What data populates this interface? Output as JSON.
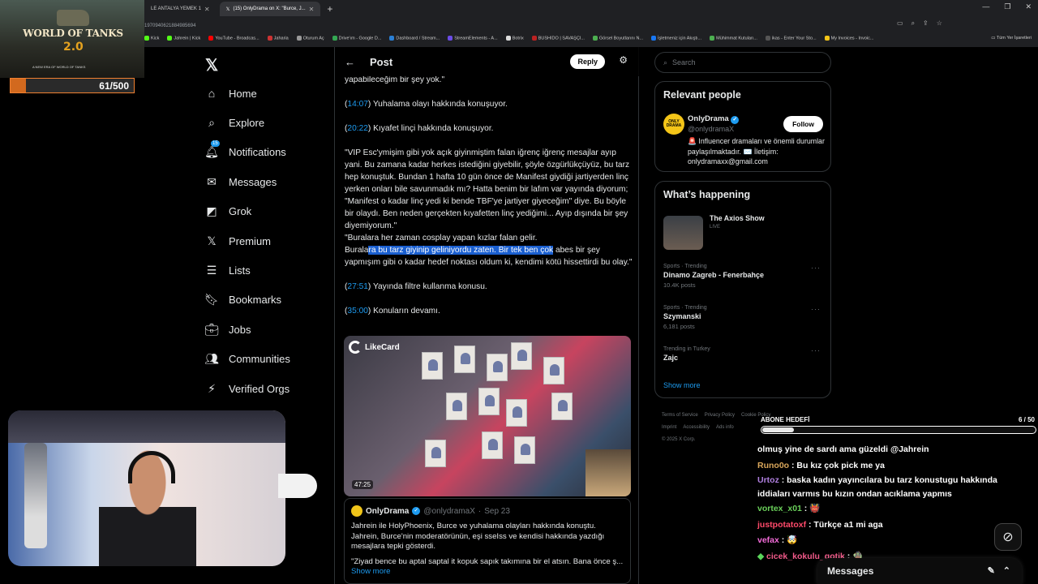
{
  "browser": {
    "tabs": [
      {
        "label": "LE ANTALYA YEMEK 1",
        "active": false
      },
      {
        "label": "(15) OnlyDrama on X: \"Burce, J...",
        "active": true
      }
    ],
    "url": "1970940621884985694",
    "bookmarks": [
      "Kick",
      "Jahrein | Kick",
      "YouTube - Broadcas...",
      "Jaharia",
      "Oturum Aç",
      "Drive'ım - Google D...",
      "Dashboard / Stream...",
      "StreamElements - A...",
      "Botrix",
      "BUSHIDO | SAVAŞÇI...",
      "Görsel Boyutlarını N...",
      "İşletmeniz için Akıştı...",
      "Mühimmat Kutuları...",
      "ikas - Enter Your Sto...",
      "My Invoices - Invoic..."
    ],
    "bookmarks_right": "Tüm Yer İşaretleri"
  },
  "game_overlay": {
    "title": "WORLD OF TANKS",
    "version": "2.0",
    "subtitle": "A NEW ERA OF WORLD OF TANKS",
    "progress_text": "61/500",
    "progress_value": 0.122
  },
  "nav": {
    "items": [
      {
        "label": "Home",
        "icon": "home-icon"
      },
      {
        "label": "Explore",
        "icon": "search-icon"
      },
      {
        "label": "Notifications",
        "icon": "bell-icon",
        "badge": "15"
      },
      {
        "label": "Messages",
        "icon": "envelope-icon"
      },
      {
        "label": "Grok",
        "icon": "grok-icon"
      },
      {
        "label": "Premium",
        "icon": "x-logo-icon"
      },
      {
        "label": "Lists",
        "icon": "list-icon"
      },
      {
        "label": "Bookmarks",
        "icon": "bookmark-icon"
      },
      {
        "label": "Jobs",
        "icon": "briefcase-icon"
      },
      {
        "label": "Communities",
        "icon": "people-icon"
      },
      {
        "label": "Verified Orgs",
        "icon": "lightning-icon"
      }
    ]
  },
  "post": {
    "header_title": "Post",
    "reply_label": "Reply",
    "line0": "yapabileceğim bir şey yok.\"",
    "ts1": "14:07",
    "ts1_text": ") Yuhalama olayı hakkında konuşuyor.",
    "ts2": "20:22",
    "ts2_text": ") Kıyafet linçi hakkında konuşuyor.",
    "quote_para": "\"VIP Esc'ymişim gibi yok açık giyinmiştim falan iğrenç iğrenç mesajlar ayıp yani. Bu zamana kadar herkes istediğini giyebilir, şöyle özgürlükçüyüz, bu tarz hep konuştuk. Bundan 1 hafta 10 gün önce de Manifest giydiği jartiyerden linç yerken onları bile savunmadık mı? Hatta benim bir lafım var yayında diyorum; \"Manifest o kadar linç yedi ki bende TBF'ye jartiyer giyeceğim\" diye. Bu böyle bir olaydı. Ben neden gerçekten kıyafetten linç yediğimi... Ayıp dışında bir şey diyemiyorum.\"",
    "cosplay_line": "\"Buralara her zaman cosplay yapan kızlar falan gelir.",
    "sel_pre": "Burala",
    "sel_mid": "ra bu tarz giyinip geliniyordu zaten. Bir tek ben çok",
    "sel_post": " abes bir şey yapmışım gibi o kadar hedef noktası oldum ki, kendimi kötü hissettirdi bu olay.\"",
    "ts3": "27:51",
    "ts3_text": ") Yayında filtre kullanma konusu.",
    "ts4": "35:00",
    "ts4_text": ") Konuların devamı.",
    "media_brand": "LikeCard",
    "media_time": "47:25",
    "quote": {
      "name": "OnlyDrama",
      "handle": "@onlydramaX",
      "date": "Sep 23",
      "text1": "Jahrein ile HolyPhoenix, Burce ve yuhalama olayları hakkında konuştu. Jahrein, Burce'nin moderatörünün, eşi sseIss ve kendisi hakkında yazdığı mesajlara tepki gösterdi.",
      "text2": "\"Ziyad bence bu aptal saptal it kopuk sapık takımına bir el atsın. Bana önce ş...",
      "show_more": "Show more"
    }
  },
  "right": {
    "search_placeholder": "Search",
    "relevant_title": "Relevant people",
    "person": {
      "name": "OnlyDrama",
      "handle": "@onlydramaX",
      "bio": "🚨 Influencer dramaları ve önemli durumlar paylaşılmaktadır. ✉️ İletişim: onlydramaxx@gmail.com",
      "follow_label": "Follow",
      "avatar_text": "ONLY DRAMA"
    },
    "happening_title": "What’s happening",
    "live_show": {
      "title": "The Axios Show",
      "status": "LIVE"
    },
    "trends": [
      {
        "category": "Sports · Trending",
        "name": "Dinamo Zagreb - Fenerbahçe",
        "posts": "10.4K posts"
      },
      {
        "category": "Sports · Trending",
        "name": "Szymanski",
        "posts": "6,181 posts"
      },
      {
        "category": "Trending in Turkey",
        "name": "Zajc",
        "posts": ""
      }
    ],
    "show_more": "Show more",
    "footer": [
      "Terms of Service",
      "Privacy Policy",
      "Cookie Policy",
      "Imprint",
      "Accessibility",
      "Ads info",
      "© 2025 X Corp."
    ]
  },
  "stream": {
    "goal_title": "ABONE HEDEFİ",
    "goal_count": "6 / 50",
    "goal_value": 0.12,
    "chat": [
      {
        "user": "",
        "text": "olmuş yine de sardı ama güzeldi @Jahrein"
      },
      {
        "user": "Runo0o",
        "text": " : Bu kız çok pick me ya"
      },
      {
        "user": "Urtoz",
        "text": " : baska kadın yayıncılara bu tarz konustugu hakkında iddiaları varmıs bu kızın ondan acıklama yapmıs"
      },
      {
        "user": "vortex_x01",
        "text": " : 👹"
      },
      {
        "user": "justpotatoxf",
        "text": " : Türkçe a1 mi aga"
      },
      {
        "user": "vefax",
        "text": " : 🤯"
      },
      {
        "user": "cicek_kokulu_gotik",
        "text": " : 🧌"
      }
    ],
    "messages_label": "Messages"
  }
}
